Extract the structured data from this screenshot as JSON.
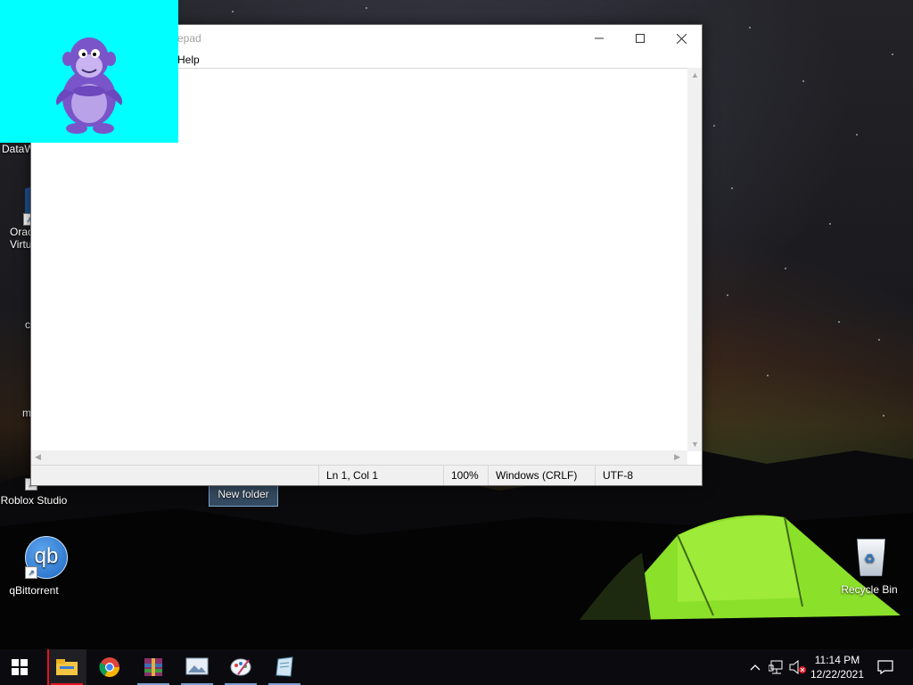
{
  "notepad": {
    "title": "Untitled - Notepad",
    "title_visible": "epad",
    "menu": {
      "help": "Help"
    },
    "text": "",
    "status": {
      "position": "Ln 1, Col 1",
      "zoom": "100%",
      "line_endings": "Windows (CRLF)",
      "encoding": "UTF-8"
    }
  },
  "desktop_icons": [
    {
      "label": "DataW",
      "icon": "datawrapper-icon"
    },
    {
      "label": "Orac\nVirtu",
      "icon": "virtualbox-icon"
    },
    {
      "label": "c",
      "icon": "text-file-icon"
    },
    {
      "label": "m",
      "icon": "text-file-icon"
    },
    {
      "label": "Roblox Studio",
      "icon": "roblox-studio-icon"
    },
    {
      "label": "qBittorrent",
      "icon": "qbittorrent-icon"
    },
    {
      "label": "New folder",
      "icon": "folder-icon"
    },
    {
      "label": "Recycle Bin",
      "icon": "recycle-bin-icon"
    }
  ],
  "qb_glyph": "qb",
  "taskbar": {
    "apps": [
      "start-icon",
      "file-explorer-icon",
      "chrome-icon",
      "winrar-icon",
      "image-viewer-icon",
      "paint-icon",
      "notepad-icon"
    ],
    "clock": {
      "time": "11:14 PM",
      "date": "12/22/2021"
    }
  },
  "colors": {
    "bonzi_bg": "#00ffff",
    "tent": "#8be02a",
    "taskbar": "#0b0b0f"
  }
}
